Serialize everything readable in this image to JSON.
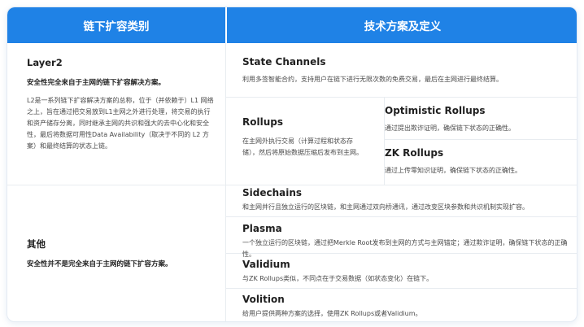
{
  "header": {
    "left": "链下扩容类别",
    "right": "技术方案及定义"
  },
  "layer2": {
    "title": "Layer2",
    "subtitle": "安全性完全来自于主网的链下扩容解决方案。",
    "description_lines": [
      "L2是一系列链下扩容解决方案的总称，位于（并依赖于）L1 网络",
      "之上，旨在通过把交易放到L1主网之外进行处理，将交易的执行",
      "和资产储存分离，同时继承主网的共识和强大的去中心化和安全",
      "性，最后将数据可用性Data Availability（取决于不同的 L2 方",
      "案）和最终结算的状态上链。"
    ]
  },
  "others": {
    "title": "其他",
    "subtitle": "安全性并不是完全来自于主网的链下扩容方案。"
  },
  "state_channels": {
    "title": "State Channels",
    "desc": "利用多签智能合约，支持用户在链下进行无限次数的免费交易，最后在主网进行最终结算。"
  },
  "rollups": {
    "title": "Rollups",
    "desc_lines": [
      "在主网外执行交易（计算过程和状态存",
      "储），然后将原始数据压缩后发布到主网。"
    ]
  },
  "optimistic_rollups": {
    "title": "Optimistic Rollups",
    "desc": "通过提出欺诈证明，确保链下状态的正确性。"
  },
  "zk_rollups": {
    "title": "ZK Rollups",
    "desc": "通过上传零知识证明，确保链下状态的正确性。"
  },
  "sidechains": {
    "title": "Sidechains",
    "desc": "和主网并行且独立运行的区块链，和主网通过双向桥通讯，通过改变区块参数和共识机制实现扩容。"
  },
  "plasma": {
    "title": "Plasma",
    "desc": "一个独立运行的区块链，通过把Merkle Root发布到主网的方式与主网锚定；通过欺诈证明，确保链下状态的正确性。"
  },
  "validium": {
    "title": "Validium",
    "desc": "与ZK Rollups类似，不同点在于交易数据（如状态变化）在链下。"
  },
  "volition": {
    "title": "Volition",
    "desc": "给用户提供两种方案的选择，使用ZK Rollups或者Validium。"
  }
}
